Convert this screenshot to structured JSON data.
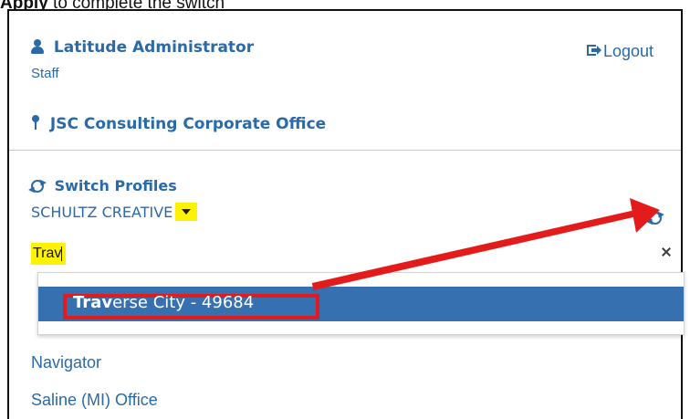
{
  "header": {
    "user_name": "Latitude Administrator",
    "user_role": "Staff",
    "logout_label": "Logout",
    "office_name": "JSC Consulting Corporate Office"
  },
  "switcher": {
    "title": "Switch Profiles",
    "current_profile": "SCHULTZ CREATIVE",
    "search_value": "Trav",
    "result_match": "Trav",
    "result_rest": "erse City - 49684"
  },
  "list": {
    "items": [
      "Navigator",
      "Saline (MI) Office"
    ]
  },
  "colors": {
    "link": "#2a6aa8",
    "highlight": "#fff200",
    "selected": "#3670b0",
    "annotation": "#e31b1b"
  },
  "icons": {
    "user": "user-icon",
    "logout": "logout-icon",
    "office": "map-pin-icon",
    "switch": "refresh-icon",
    "dropdown": "caret-down-icon",
    "clear": "close-icon",
    "annotation_arrow": "red-arrow-icon"
  }
}
